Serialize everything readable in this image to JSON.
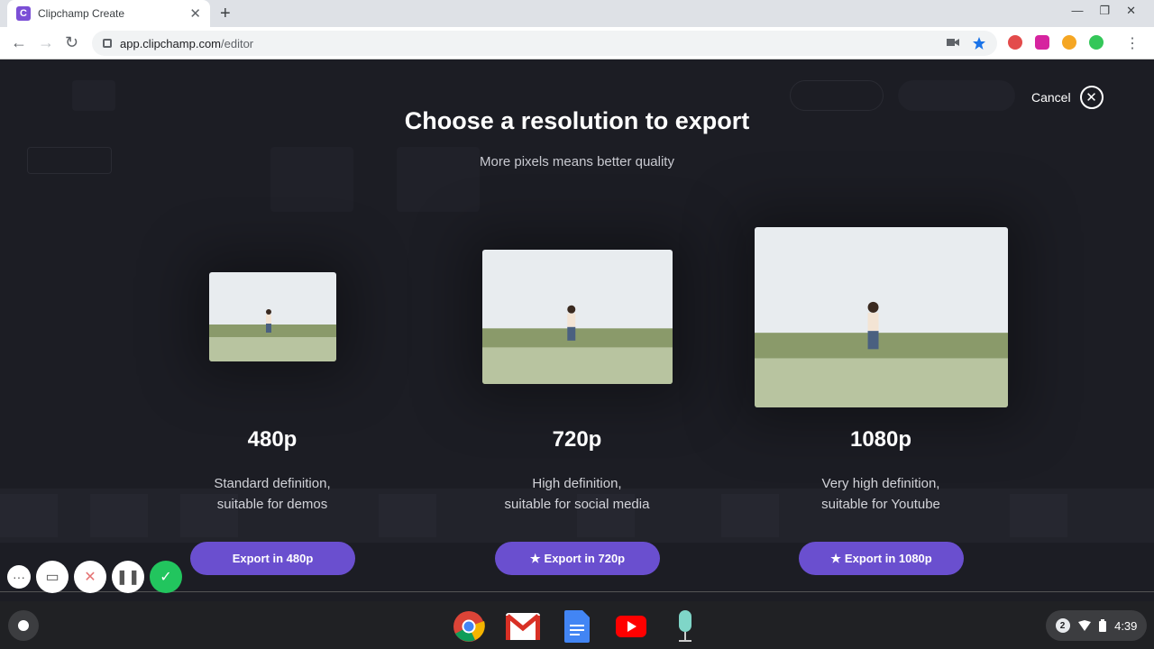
{
  "browser": {
    "tab_title": "Clipchamp Create",
    "tab_favicon_letter": "C",
    "url_host": "app.clipchamp.com",
    "url_path": "/editor"
  },
  "modal": {
    "title": "Choose a resolution to export",
    "subtitle": "More pixels means better quality",
    "cancel_label": "Cancel",
    "options": [
      {
        "resolution": "480p",
        "desc_line1": "Standard definition,",
        "desc_line2": "suitable for demos",
        "button_label": "Export in 480p",
        "premium": false
      },
      {
        "resolution": "720p",
        "desc_line1": "High definition,",
        "desc_line2": "suitable for social media",
        "button_label": "Export in 720p",
        "premium": true
      },
      {
        "resolution": "1080p",
        "desc_line1": "Very high definition,",
        "desc_line2": "suitable for Youtube",
        "button_label": "Export in 1080p",
        "premium": true
      }
    ]
  },
  "shelf": {
    "notification_count": "2",
    "clock": "4:39"
  },
  "colors": {
    "accent": "#6a4fcf",
    "background": "#1c1d24",
    "confirm_green": "#22c55e"
  }
}
